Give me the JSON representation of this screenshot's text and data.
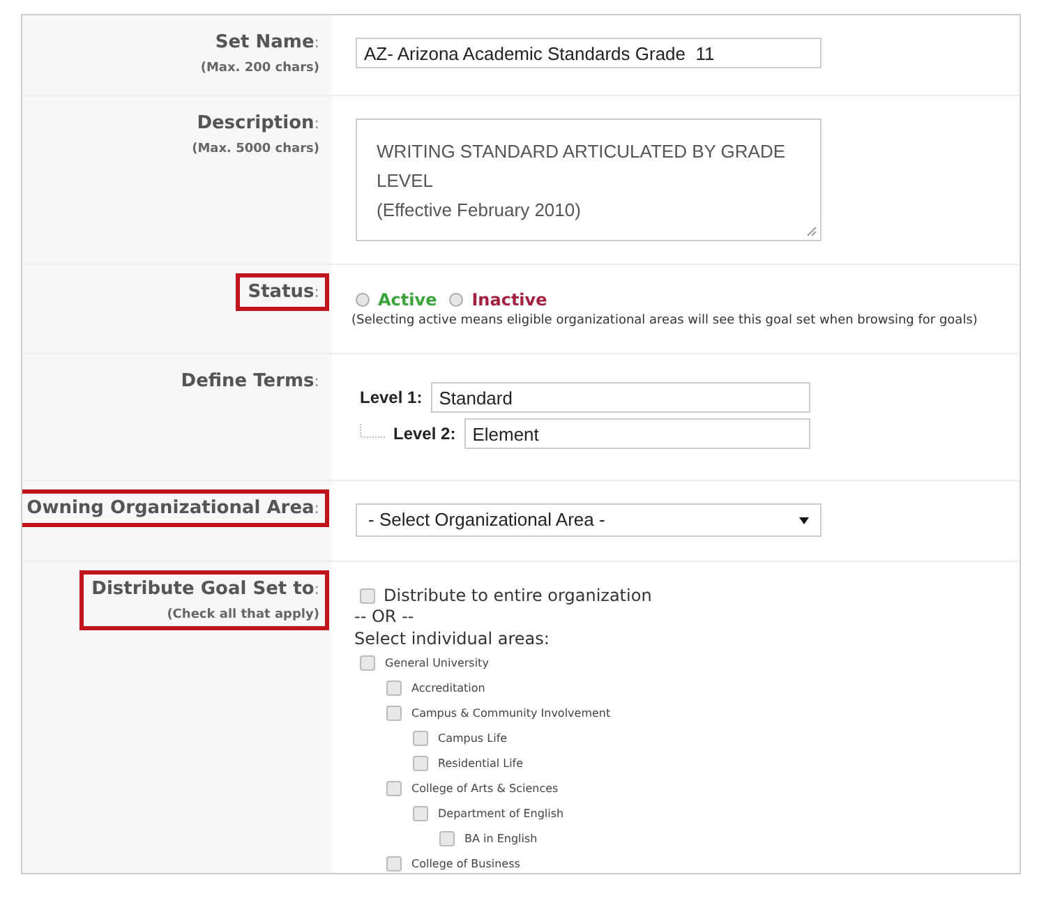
{
  "set_name": {
    "label": "Set Name",
    "colon": ":",
    "hint": "(Max. 200 chars)",
    "highlighted": false,
    "value": "AZ- Arizona Academic Standards Grade  11"
  },
  "description": {
    "label": "Description",
    "colon": ":",
    "hint": "(Max. 5000 chars)",
    "highlighted": false,
    "value": "WRITING STANDARD ARTICULATED BY GRADE LEVEL\n(Effective February 2010)"
  },
  "status": {
    "label": "Status",
    "colon": ":",
    "highlighted": true,
    "options": [
      {
        "label": "Active",
        "selected": false,
        "color": "#3aa33a"
      },
      {
        "label": "Inactive",
        "selected": false,
        "color": "#a3203f"
      }
    ],
    "note": "(Selecting active means eligible organizational areas will see this goal set when browsing for goals)"
  },
  "define_terms": {
    "label": "Define Terms",
    "colon": ":",
    "highlighted": false,
    "levels": [
      {
        "label": "Level 1:",
        "value": "Standard"
      },
      {
        "label": "Level 2:",
        "value": "Element"
      }
    ]
  },
  "owning_area": {
    "label": "Owning Organizational Area",
    "colon": ":",
    "highlighted": true,
    "value": "- Select Organizational Area -"
  },
  "distribute": {
    "label": "Distribute Goal Set to",
    "colon": ":",
    "hint": "(Check all that apply)",
    "highlighted": true,
    "entire": {
      "label": "Distribute to entire organization",
      "checked": false
    },
    "or": "-- OR --",
    "select_label": "Select individual areas:",
    "areas": [
      {
        "label": "General University",
        "checked": false,
        "children": [
          {
            "label": "Accreditation",
            "checked": false
          },
          {
            "label": "Campus & Community Involvement",
            "checked": false,
            "children": [
              {
                "label": "Campus Life",
                "checked": false
              },
              {
                "label": "Residential Life",
                "checked": false
              }
            ]
          },
          {
            "label": "College of Arts & Sciences",
            "checked": false,
            "children": [
              {
                "label": "Department of English",
                "checked": false,
                "children": [
                  {
                    "label": "BA in English",
                    "checked": false
                  }
                ]
              }
            ]
          },
          {
            "label": "College of Business",
            "checked": false
          }
        ]
      }
    ]
  }
}
